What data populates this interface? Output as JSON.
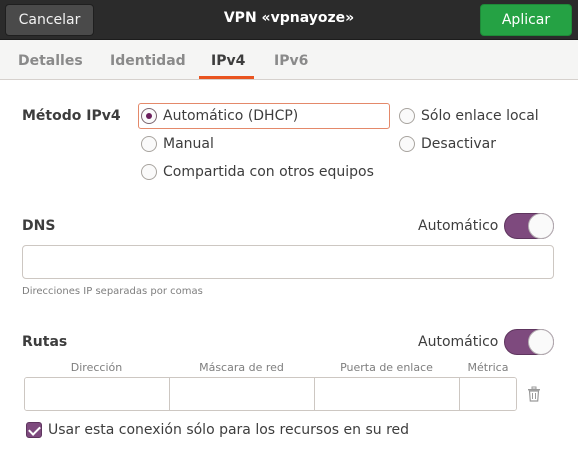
{
  "header": {
    "cancel_label": "Cancelar",
    "title": "VPN «vpnayoze»",
    "apply_label": "Aplicar"
  },
  "tabs": [
    {
      "label": "Detalles",
      "active": false
    },
    {
      "label": "Identidad",
      "active": false
    },
    {
      "label": "IPv4",
      "active": true
    },
    {
      "label": "IPv6",
      "active": false
    }
  ],
  "ipv4_method": {
    "label": "Método IPv4",
    "options": [
      {
        "label": "Automático (DHCP)",
        "checked": true
      },
      {
        "label": "Sólo enlace local",
        "checked": false
      },
      {
        "label": "Manual",
        "checked": false
      },
      {
        "label": "Desactivar",
        "checked": false
      },
      {
        "label": "Compartida con otros equipos",
        "checked": false
      }
    ]
  },
  "dns": {
    "label": "DNS",
    "auto_label": "Automático",
    "auto_enabled": true,
    "value": "",
    "hint": "Direcciones IP separadas por comas"
  },
  "routes": {
    "label": "Rutas",
    "auto_label": "Automático",
    "auto_enabled": true,
    "columns": [
      "Dirección",
      "Máscara de red",
      "Puerta de enlace",
      "Métrica"
    ],
    "rows": [
      [
        "",
        "",
        "",
        ""
      ]
    ]
  },
  "only_resources": {
    "label": "Usar esta conexión sólo para los recursos en su red",
    "checked": true
  },
  "colors": {
    "accent_orange": "#e95420",
    "toggle_purple": "#7e4a7e",
    "apply_green": "#25a244",
    "header_dark": "#2b2b2b"
  }
}
